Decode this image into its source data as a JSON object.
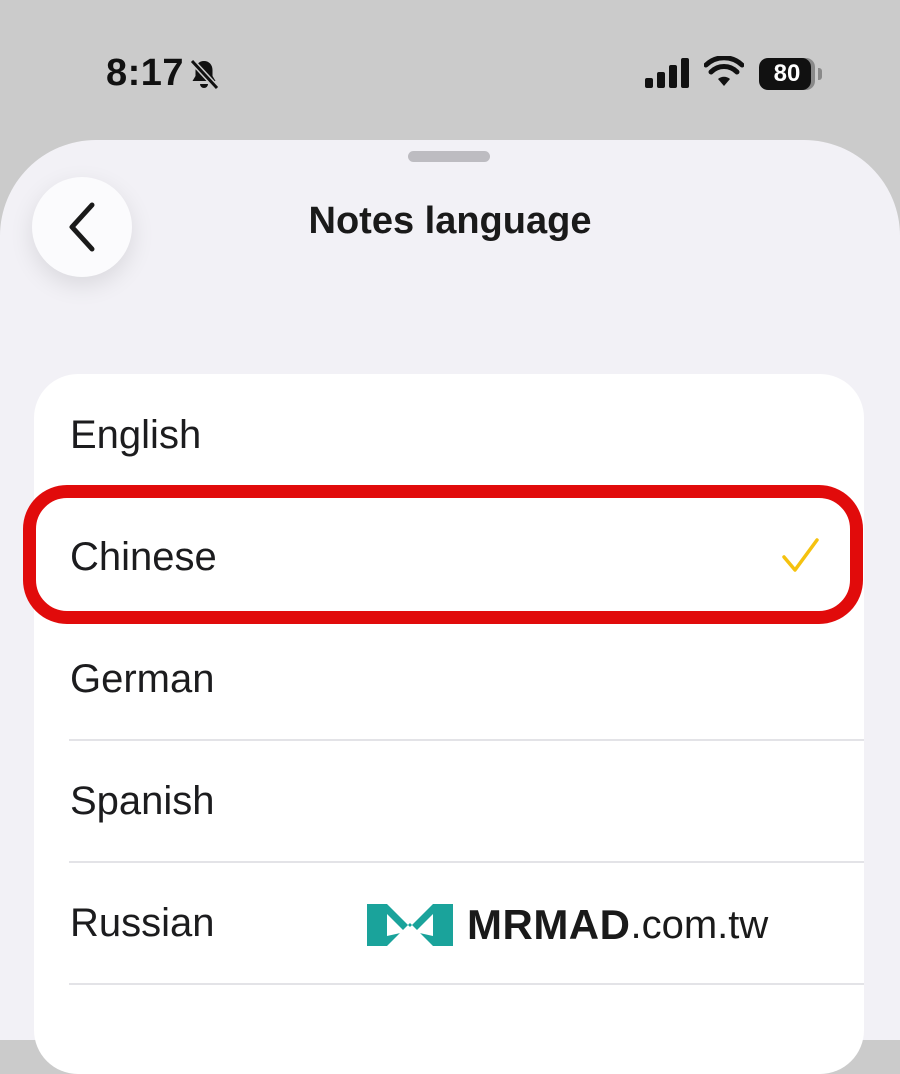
{
  "status_bar": {
    "time": "8:17",
    "battery": "80",
    "icons": [
      "bell-slash-icon",
      "cellular-signal-icon",
      "wifi-icon",
      "battery-icon"
    ]
  },
  "header": {
    "title": "Notes language",
    "back_icon": "chevron-left-icon"
  },
  "languages": [
    {
      "label": "English",
      "selected": false
    },
    {
      "label": "Chinese",
      "selected": true
    },
    {
      "label": "German",
      "selected": false
    },
    {
      "label": "Spanish",
      "selected": false
    },
    {
      "label": "Russian",
      "selected": false
    }
  ],
  "colors": {
    "accent_check": "#f5c20f",
    "highlight_border": "#e10b0b",
    "sheet_background": "#f2f1f6",
    "watermark_logo": "#1aa39b"
  },
  "watermark": {
    "brand": "MRMAD",
    "suffix": ".com.tw"
  }
}
